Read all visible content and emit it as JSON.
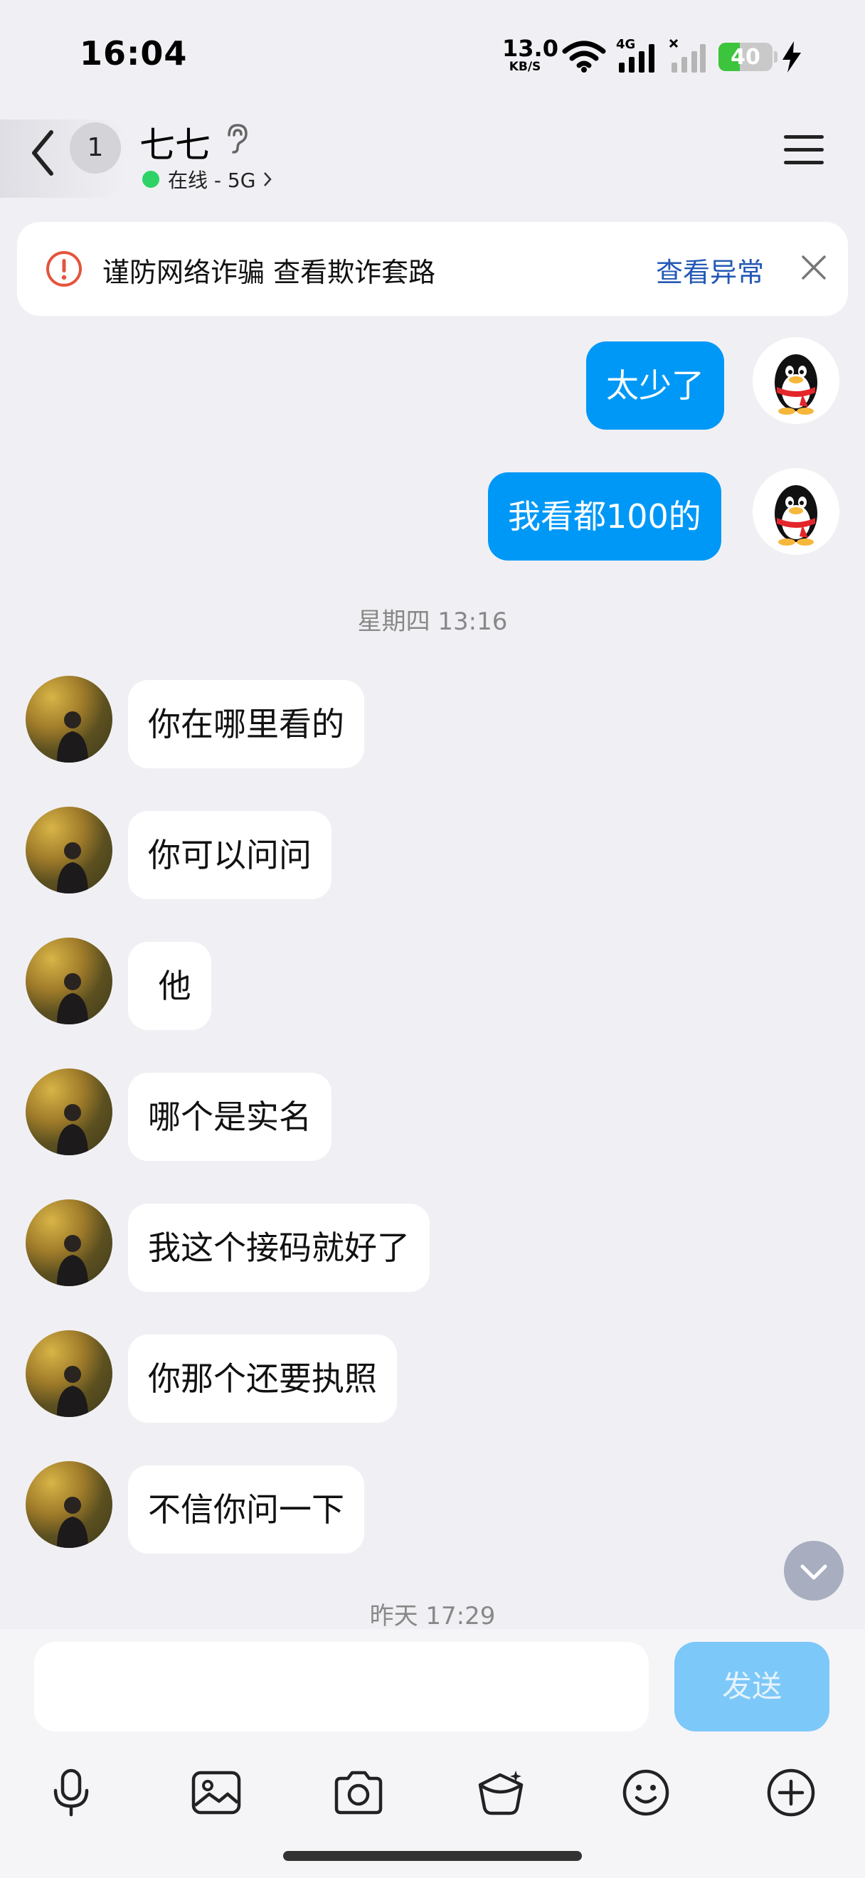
{
  "status_bar": {
    "time": "16:04",
    "net_speed_value": "13.0",
    "net_speed_unit": "KB/S",
    "network_type": "4G",
    "battery_level": "40",
    "battery_fraction": 0.4
  },
  "header": {
    "unread_count": "1",
    "contact_name": "七七",
    "status_text": "在线 - 5G"
  },
  "banner": {
    "text": "谨防网络诈骗 查看欺诈套路",
    "link": "查看异常"
  },
  "messages": [
    {
      "side": "out",
      "text": "太少了"
    },
    {
      "side": "out",
      "text": "我看都100的"
    },
    {
      "side": "time",
      "text": "星期四 13:16"
    },
    {
      "side": "in",
      "text": "你在哪里看的"
    },
    {
      "side": "in",
      "text": "你可以问问"
    },
    {
      "side": "in",
      "text": " 他"
    },
    {
      "side": "in",
      "text": "哪个是实名"
    },
    {
      "side": "in",
      "text": "我这个接码就好了"
    },
    {
      "side": "in",
      "text": "你那个还要执照"
    },
    {
      "side": "in",
      "text": "不信你问一下"
    },
    {
      "side": "time",
      "text": "昨天 17:29"
    }
  ],
  "composer": {
    "input_value": "",
    "send_label": "发送"
  },
  "toolbar": {
    "icons": [
      "microphone-icon",
      "image-icon",
      "camera-icon",
      "red-packet-icon",
      "emoji-icon",
      "plus-icon"
    ]
  },
  "colors": {
    "outgoing_bubble": "#0098f7",
    "online": "#2dd465",
    "link": "#2358b6",
    "send_disabled": "#7cc8f9"
  }
}
